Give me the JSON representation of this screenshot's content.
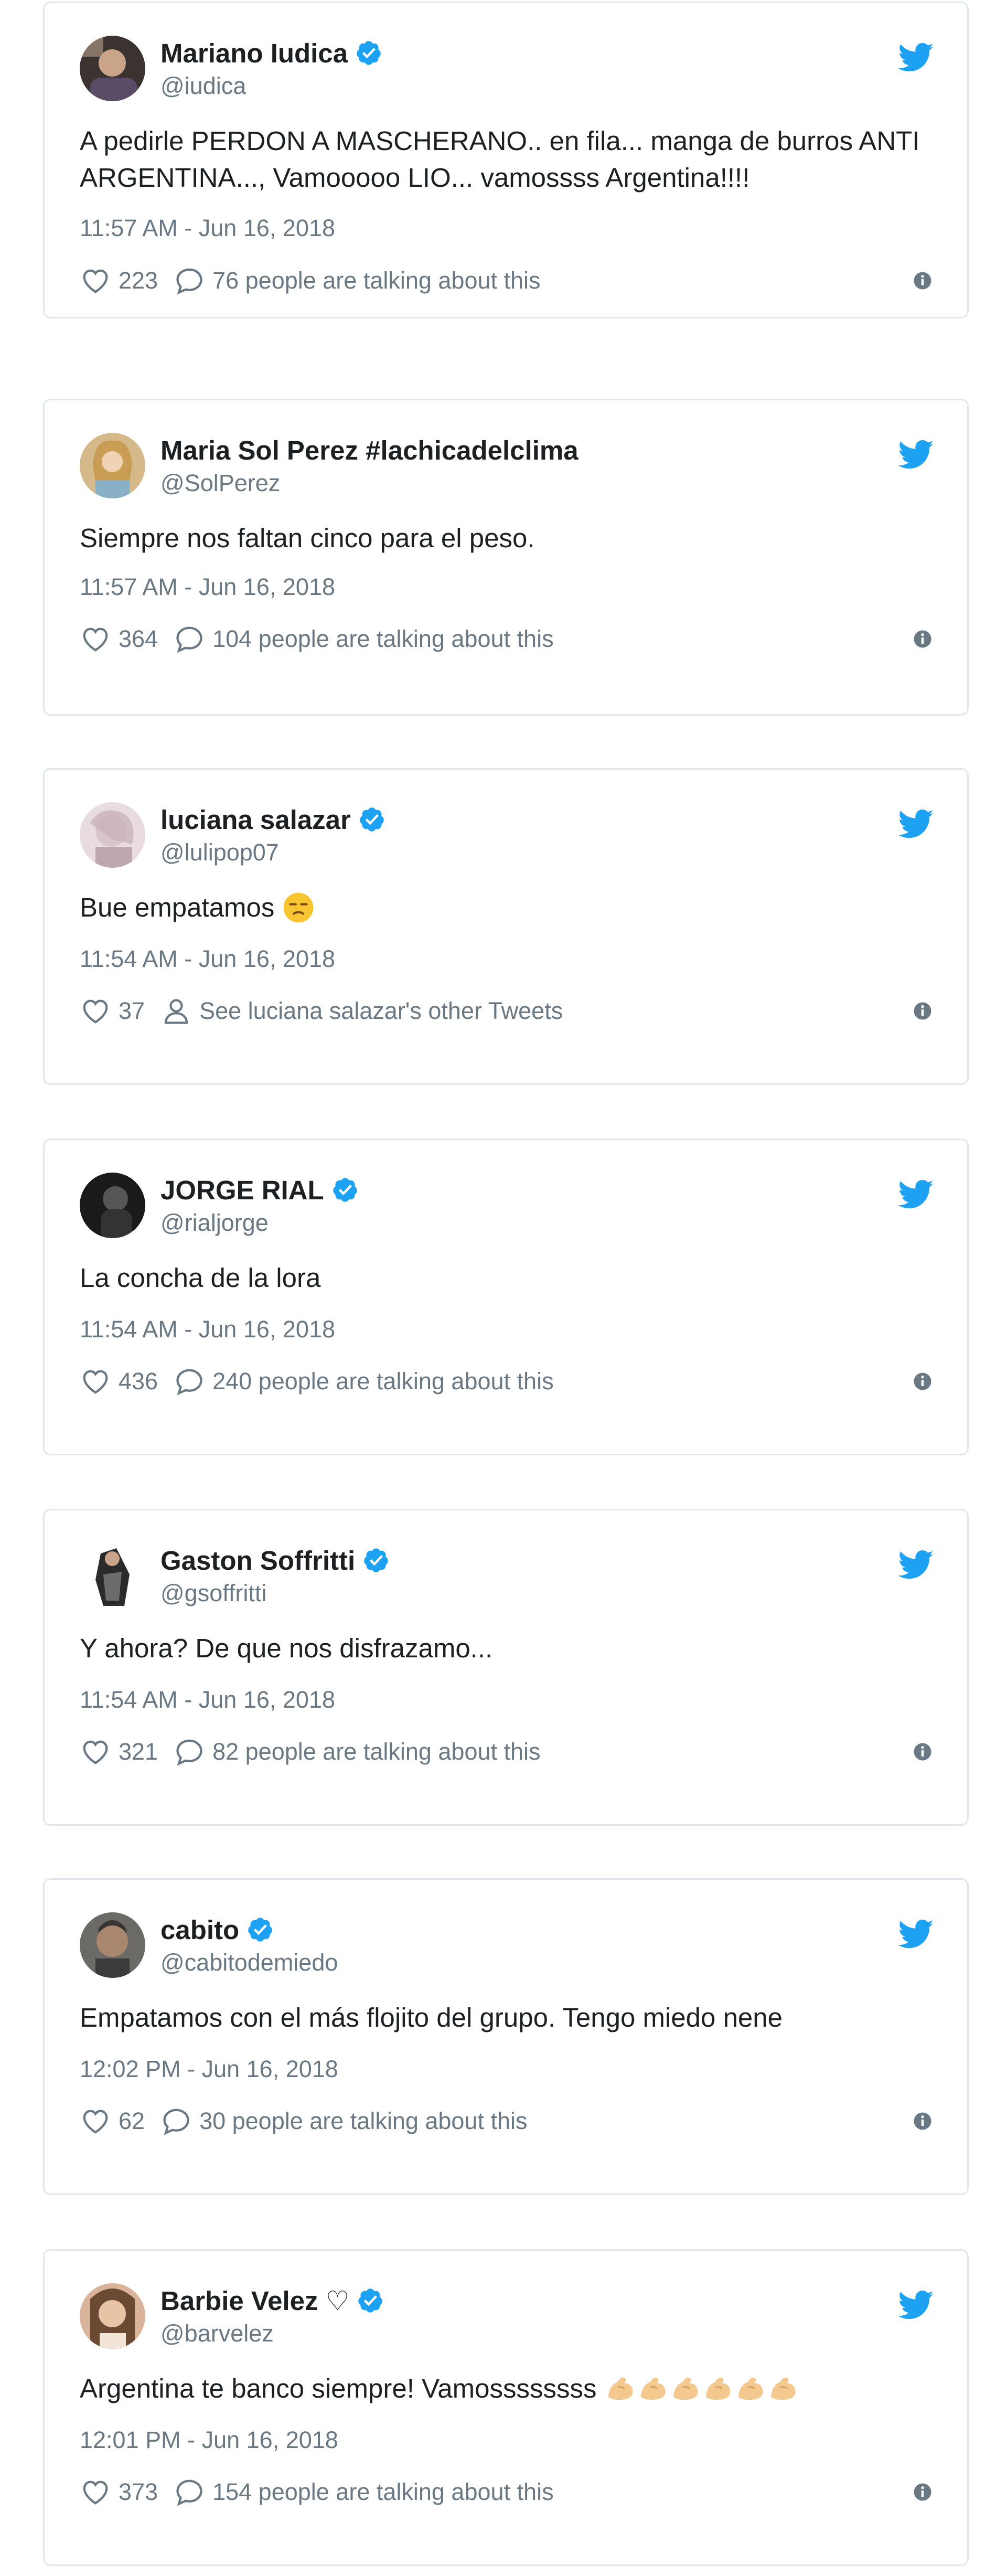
{
  "colors": {
    "twitter_blue": "#1da1f2",
    "muted_text": "#697882",
    "border": "#e1e8ed",
    "text": "#1c2022"
  },
  "tweets": [
    {
      "name": "Mariano Iudica",
      "handle": "@iudica",
      "verified": true,
      "text": "A pedirle PERDON A MASCHERANO.. en fila... manga de burros ANTI ARGENTINA..., Vamooooo LIO... vamossss Argentina!!!!",
      "time": "11:57 AM - Jun 16, 2018",
      "likes": "223",
      "action_text": "76 people are talking about this",
      "action_icon": "comment-icon"
    },
    {
      "name": "Maria Sol Perez #lachicadelclima",
      "handle": "@SolPerez",
      "verified": false,
      "text": "Siempre nos faltan cinco para el peso.",
      "time": "11:57 AM - Jun 16, 2018",
      "likes": "364",
      "action_text": "104 people are talking about this",
      "action_icon": "comment-icon"
    },
    {
      "name": "luciana salazar",
      "handle": "@lulipop07",
      "verified": true,
      "text": "Bue empatamos",
      "time": "11:54 AM - Jun 16, 2018",
      "likes": "37",
      "action_text": "See luciana salazar's other Tweets",
      "action_icon": "person-icon"
    },
    {
      "name": "JORGE RIAL",
      "handle": "@rialjorge",
      "verified": true,
      "text": "La concha de la lora",
      "time": "11:54 AM - Jun 16, 2018",
      "likes": "436",
      "action_text": "240 people are talking about this",
      "action_icon": "comment-icon"
    },
    {
      "name": "Gaston Soffritti",
      "handle": "@gsoffritti",
      "verified": true,
      "text": "Y ahora? De que nos disfrazamo...",
      "time": "11:54 AM - Jun 16, 2018",
      "likes": "321",
      "action_text": "82 people are talking about this",
      "action_icon": "comment-icon"
    },
    {
      "name": "cabito",
      "handle": "@cabitodemiedo",
      "verified": true,
      "text": "Empatamos con el más flojito del grupo. Tengo miedo nene",
      "time": "12:02 PM - Jun 16, 2018",
      "likes": "62",
      "action_text": "30 people are talking about this",
      "action_icon": "comment-icon"
    },
    {
      "name": "Barbie Velez ♡",
      "handle": "@barvelez",
      "verified": true,
      "text": "Argentina te banco siempre! Vamossssssss",
      "time": "12:01 PM - Jun 16, 2018",
      "likes": "373",
      "action_text": "154 people are talking about this",
      "action_icon": "comment-icon"
    }
  ]
}
